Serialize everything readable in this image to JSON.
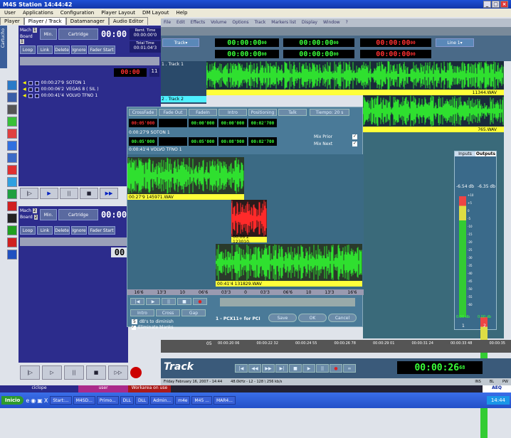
{
  "app": {
    "title": "M4S Station 14:44:42",
    "menus": [
      "User",
      "Applications",
      "Configuration",
      "Player Layout",
      "DM Layout",
      "Help"
    ],
    "tabs": [
      "Player",
      "Player / Track",
      "Datamanager",
      "Audio Editor"
    ]
  },
  "player1": {
    "mach": "Mach",
    "mach_no": "1",
    "board": "Board",
    "board_no": "1",
    "min_label": "Min.",
    "cartridge": "Cartridge",
    "time": "00:00",
    "remt_label": "Remt. Time",
    "remt_value": "00:00:00'0",
    "total_label": "Total Time",
    "total_value": "00:01:04'3",
    "buttons": [
      "Loop",
      "Link",
      "Delete",
      "Ignore",
      "Fader Start"
    ],
    "side_label": "Cartucho",
    "counter": "11",
    "items": [
      {
        "time": "00:00:27'9",
        "name": "SOTON 1"
      },
      {
        "time": "00:00:06'2",
        "name": "VEGAS 8 ( SIL )"
      },
      {
        "time": "00:00:41'4",
        "name": "VOLVO TFNO 1"
      }
    ]
  },
  "player2": {
    "mach": "Mach",
    "mach_no": "2",
    "board": "Board",
    "board_no": "2",
    "min_label": "Min.",
    "cartridge": "Cartridge",
    "time": "00:00",
    "buttons": [
      "Loop",
      "Link",
      "Delete",
      "Ignore",
      "Fader Start"
    ],
    "lcd": "00"
  },
  "track": {
    "menus": [
      "File",
      "Edit",
      "Effects",
      "Volume",
      "Options",
      "Track",
      "Markers list",
      "Display",
      "Window",
      "?"
    ],
    "track_label": "Track",
    "times": [
      "00:00:00",
      "00:00:00",
      "00:00:00"
    ],
    "times_sup": [
      "00",
      "00",
      "00"
    ],
    "times2": [
      "00:00:00",
      "00:00:00",
      "00:00:00"
    ],
    "times2_sup": [
      "00",
      "00",
      "00"
    ],
    "line_label": "Line 1",
    "track1": "1 . Track 1",
    "track2": "2 . Track 2",
    "file1": "11344.WAV",
    "file2": "765.WAV",
    "ruler": [
      "00:00:20 06",
      "00:00:22 32",
      "00:00:24 55",
      "00:00:26 78",
      "00:00:29 01",
      "00:00:31 24",
      "00:00:33 48",
      "00:00:35 "
    ],
    "ruler_prefix": "05",
    "logo": "Track",
    "main_time": "00:00:26",
    "main_time_sup": "68",
    "status": "Friday February 16, 2007 - 14:44",
    "format": "48.0kHz - L2 - 128 \\ 256 kb/s",
    "flags": [
      "INS",
      "BL",
      "PW"
    ]
  },
  "crossfade": {
    "tabs": [
      "CrossFade",
      "Fade Out",
      "FadeIn",
      "Intro",
      "Positioning",
      "Talk"
    ],
    "tiempo": "Tiempo: 20 s",
    "r1": [
      "00:05'000",
      "",
      "00:00'000",
      "00:00'000",
      "00:02'700"
    ],
    "r2": [
      "00:05'000",
      "",
      "00:05'000",
      "00:08'900",
      "00:02'700"
    ],
    "clip1": "0:00:27'9  SOTON 1",
    "clip2": "0:00:41'4  VOLVO TFNO 1",
    "mix_prior": "Mix Prior",
    "mix_next": "Mix Next",
    "w1": "00:27'9    145971.WAV",
    "w2": "00:06'2    123010.",
    "w3": "00:41'4    131829.WAV",
    "ruler": [
      "16'6",
      "13'3",
      "10",
      "06'6",
      "03'3",
      "0",
      "03'3",
      "06'6",
      "10",
      "13'3",
      "16'6"
    ],
    "buttons": [
      "Intro",
      "Cross",
      "Gap"
    ],
    "db_value": "5",
    "db_label": "dB's to diminish",
    "eliminate": "Eliminate blanks",
    "device": "1 - PCX11+ for PCI",
    "save": "Save",
    "ok": "OK",
    "cancel": "Cancel"
  },
  "meters": {
    "tabs": [
      "Inputs",
      "Outputs"
    ],
    "left": "-6.54 db",
    "right": "-6.35 db",
    "bottom_l": "0.00 db",
    "bottom_r": "0.00 db",
    "ch": [
      "1",
      "2"
    ],
    "scale": [
      "+10",
      "+5",
      "0",
      "-5",
      "-10",
      "-15",
      "-20",
      "-25",
      "-30",
      "-35",
      "-40",
      "-45",
      "-50",
      "-55",
      "-60"
    ]
  },
  "bottom_bar": {
    "ciclope": "ciclope",
    "user": "user",
    "workarea": "Workarea on use"
  },
  "taskbar": {
    "start": "Inicio",
    "items": [
      "Start:...",
      "M4SD...",
      "Primo...",
      "DLL",
      "DLL",
      "Admin...",
      "m4e",
      "M45 ...",
      "MAR4..."
    ],
    "clock": "14:44",
    "brand": "AEQ"
  }
}
